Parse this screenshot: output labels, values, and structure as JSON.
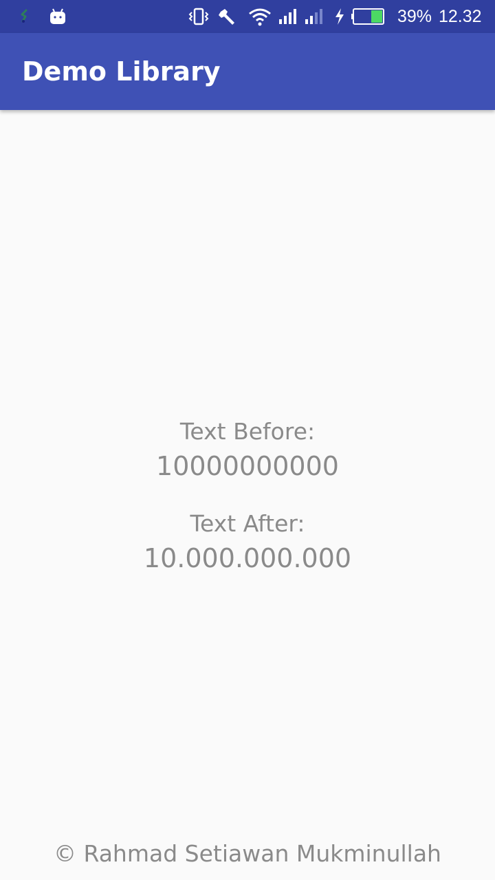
{
  "status_bar": {
    "battery_percent": "39%",
    "time": "12.32",
    "battery_level": 0.39,
    "icons": [
      "app-notification-icon",
      "android-icon",
      "vibrate-icon",
      "wrench-icon",
      "wifi-icon",
      "signal-icon",
      "signal-weak-icon",
      "charging-icon",
      "battery-icon"
    ],
    "colors": {
      "background": "#303f9f",
      "battery_fill": "#4cd964"
    }
  },
  "app_bar": {
    "title": "Demo Library",
    "background": "#3f51b5"
  },
  "main": {
    "before_label": "Text Before:",
    "before_value": "10000000000",
    "after_label": "Text After:",
    "after_value": "10.000.000.000"
  },
  "footer": {
    "copyright": "© Rahmad Setiawan Mukminullah"
  }
}
